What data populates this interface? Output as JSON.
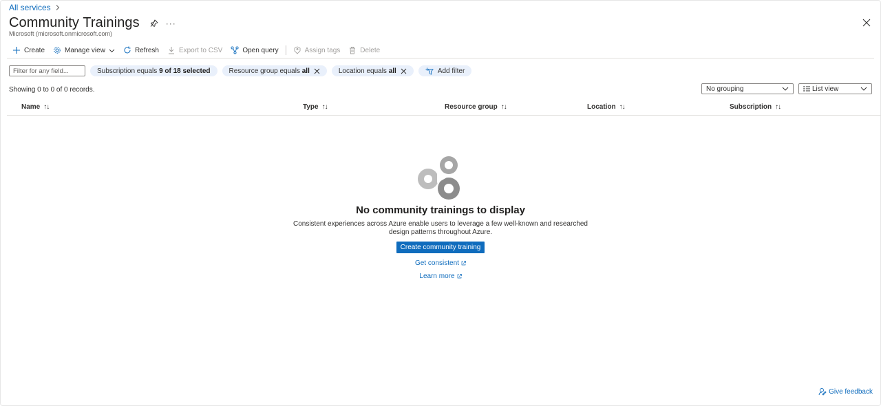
{
  "breadcrumb": {
    "item": "All services"
  },
  "header": {
    "title": "Community Trainings",
    "subtitle": "Microsoft (microsoft.onmicrosoft.com)",
    "more": "···"
  },
  "toolbar": {
    "create": "Create",
    "manage_view": "Manage view",
    "refresh": "Refresh",
    "export": "Export to CSV",
    "open_query": "Open query",
    "assign_tags": "Assign tags",
    "delete": "Delete"
  },
  "filters": {
    "placeholder": "Filter for any field...",
    "subscription": {
      "prefix": "Subscription equals",
      "value": "9 of 18 selected"
    },
    "resource_group": {
      "prefix": "Resource group equals",
      "value": "all"
    },
    "location": {
      "prefix": "Location equals",
      "value": "all"
    },
    "add_filter": "Add filter"
  },
  "records": "Showing 0 to 0 of 0 records.",
  "grouping": {
    "selected": "No grouping"
  },
  "view": {
    "selected": "List view"
  },
  "table": {
    "columns": [
      "Name",
      "Type",
      "Resource group",
      "Location",
      "Subscription"
    ],
    "sort_asc": "↑↓",
    "sort_both": "↑↓"
  },
  "empty_state": {
    "title": "No community trainings to display",
    "description": "Consistent experiences across Azure enable users to leverage a few well-known and researched design patterns throughout Azure.",
    "button": "Create community training",
    "link1": "Get consistent",
    "link2": "Learn more"
  },
  "footer": {
    "feedback": "Give feedback"
  },
  "colors": {
    "accent": "#0f6cbd",
    "pill_bg": "#e9f0fb",
    "text": "#323130"
  }
}
